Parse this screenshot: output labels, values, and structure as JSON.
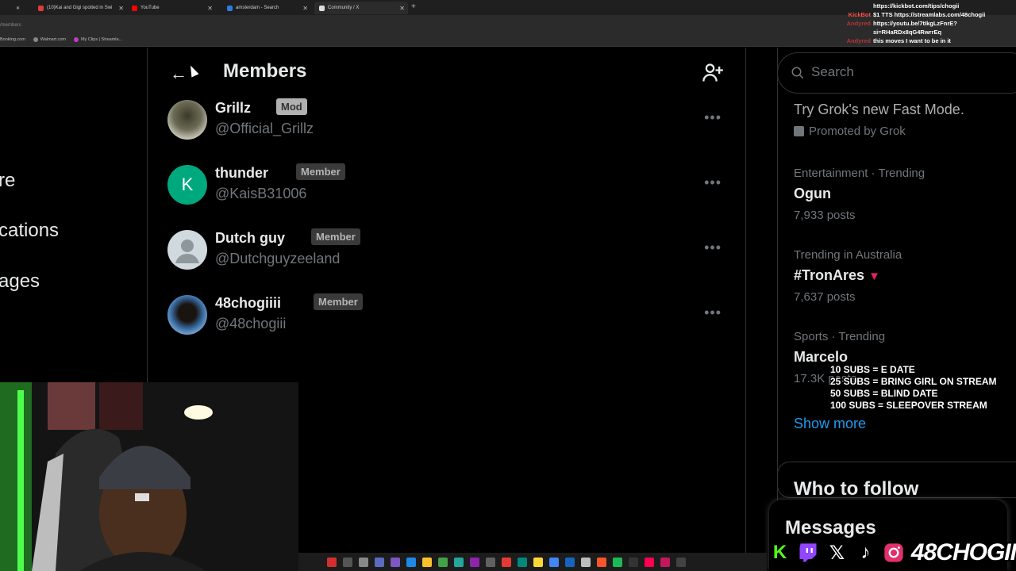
{
  "browser": {
    "tabs": [
      {
        "label": "(10)Kai and Gigi spotted in Swi",
        "color": "#e23c3c",
        "active": false
      },
      {
        "label": "YouTube",
        "color": "#ff0000",
        "active": false
      },
      {
        "label": "amsterdam - Search",
        "color": "#2a7de1",
        "active": false
      },
      {
        "label": "Community / X",
        "color": "#dddddd",
        "active": true
      }
    ],
    "new_tab": "+",
    "url_fragment": "/members",
    "bookmarks": [
      "Booking.com",
      "Walmart.com",
      "My Clips | Streamla..."
    ]
  },
  "left_nav": {
    "items": [
      "re",
      "cations",
      "ages"
    ]
  },
  "header": {
    "back_label": "←",
    "title": "Members"
  },
  "members": [
    {
      "name": "Grillz",
      "role": "Mod",
      "handle": "@Official_Grillz",
      "more": "•••"
    },
    {
      "name": "thunder",
      "role": "Member",
      "handle": "@KaisB31006",
      "more": "•••",
      "initial": "K"
    },
    {
      "name": "Dutch guy",
      "role": "Member",
      "handle": "@Dutchguyzeeland",
      "more": "•••"
    },
    {
      "name": "48chogiiii",
      "role": "Member",
      "handle": "@48chogiii",
      "more": "•••"
    }
  ],
  "sidebar": {
    "search_placeholder": "Search",
    "promo": {
      "title": "Try Grok's new Fast Mode.",
      "by": "Promoted by Grok"
    },
    "trends": [
      {
        "meta": "Entertainment · Trending",
        "name": "Ogun",
        "count": "7,933 posts"
      },
      {
        "meta": "Trending in Australia",
        "name": "#TronAres",
        "count": "7,637 posts"
      },
      {
        "meta": "Sports · Trending",
        "name": "Marcelo",
        "count": "17.3K posts"
      }
    ],
    "show_more": "Show more",
    "who_to_follow": "Who to follow",
    "messages": "Messages"
  },
  "stream": {
    "chat": [
      {
        "user": "",
        "msg": "https://kickbot.com/tips/chogii",
        "color": "#ff4d4d"
      },
      {
        "user": "KickBot",
        "msg": "$1 TTS https://streamlabs.com/48chogii",
        "color": "#ff4d4d"
      },
      {
        "user": "Andyred",
        "msg": "https://youtu.be/7tIkgLzFnrE?",
        "color": "#b5343a"
      },
      {
        "user": "",
        "msg": "si=RHaRDx8qG4RwrrEq",
        "color": "#b5343a"
      },
      {
        "user": "Andyred",
        "msg": "this moves I want to be in it",
        "color": "#b5343a"
      }
    ],
    "goals": [
      "10 SUBS = E DATE",
      "25 SUBS = BRING GIRL ON STREAM",
      "50 SUBS = BLIND DATE",
      "100 SUBS = SLEEPOVER STREAM"
    ],
    "brand": "48CHOGII",
    "social_icons": [
      "kick-icon",
      "twitch-icon",
      "x-icon",
      "tiktok-icon",
      "instagram-icon"
    ],
    "colors": {
      "kick": "#53fc18",
      "twitch": "#9146ff",
      "instagram": "#e1306c",
      "accent": "#1d9bf0"
    }
  }
}
